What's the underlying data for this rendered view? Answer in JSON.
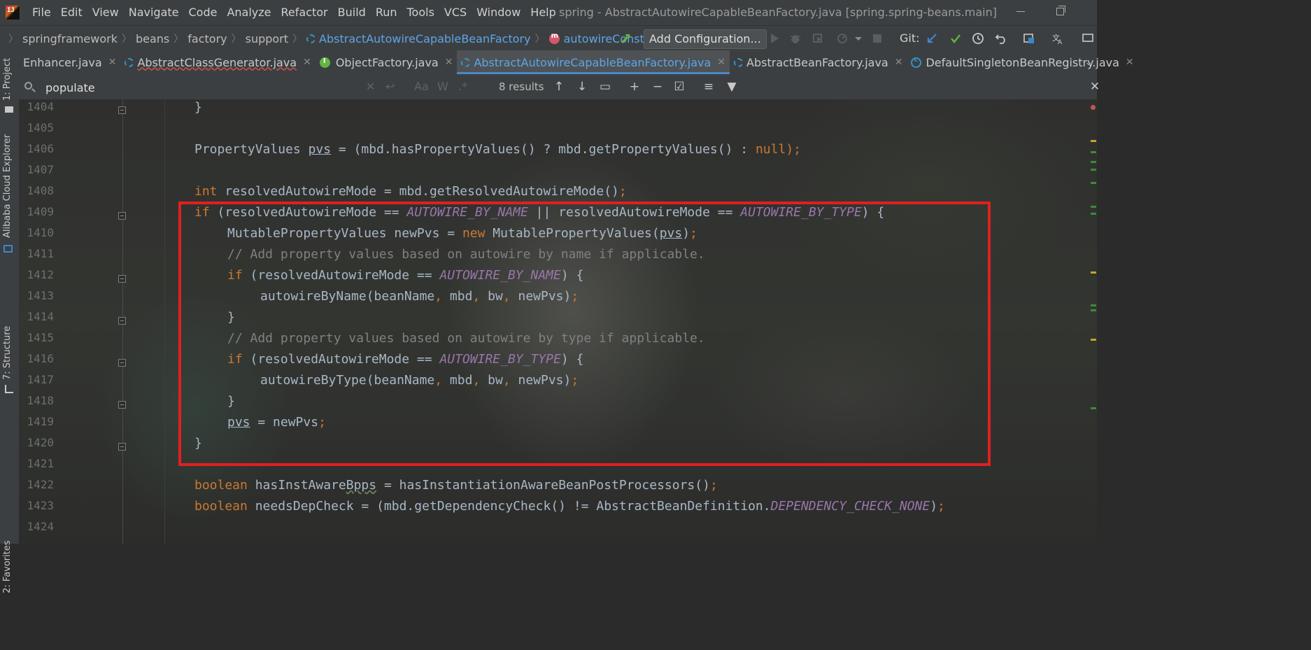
{
  "app": {
    "menu": [
      "File",
      "Edit",
      "View",
      "Navigate",
      "Code",
      "Analyze",
      "Refactor",
      "Build",
      "Run",
      "Tools",
      "VCS",
      "Window",
      "Help"
    ],
    "title": "spring - AbstractAutowireCapableBeanFactory.java [spring.spring-beans.main]"
  },
  "breadcrumb": {
    "items": [
      "springframework",
      "beans",
      "factory",
      "support",
      "AbstractAutowireCapableBeanFactory",
      "autowireConstructor"
    ]
  },
  "toolbar": {
    "add_configuration": "Add Configuration...",
    "git_label": "Git:"
  },
  "left_tools": {
    "project": "1: Project",
    "alibaba": "Alibaba Cloud Explorer",
    "structure": "7: Structure",
    "favorites": "2: Favorites"
  },
  "tabs": [
    {
      "label": "Enhancer.java",
      "icon": "none"
    },
    {
      "label": "AbstractClassGenerator.java",
      "icon": "abstract-class-icon"
    },
    {
      "label": "ObjectFactory.java",
      "icon": "interface-icon"
    },
    {
      "label": "AbstractAutowireCapableBeanFactory.java",
      "icon": "abstract-class-icon",
      "active": true
    },
    {
      "label": "AbstractBeanFactory.java",
      "icon": "abstract-class-icon"
    },
    {
      "label": "DefaultSingletonBeanRegistry.java",
      "icon": "class-icon"
    }
  ],
  "search": {
    "query": "populate",
    "results": "8 results",
    "match_case": "Aa",
    "words": "W",
    "regex": ".*"
  },
  "editor": {
    "line_numbers": [
      "1404",
      "1405",
      "1406",
      "1407",
      "1408",
      "1409",
      "1410",
      "1411",
      "1412",
      "1413",
      "1414",
      "1415",
      "1416",
      "1417",
      "1418",
      "1419",
      "1420",
      "1421",
      "1422",
      "1423",
      "1424"
    ],
    "lines": {
      "l1404": "}",
      "l1406_a": "PropertyValues ",
      "l1406_b": "pvs",
      "l1406_c": " = (mbd.hasPropertyValues() ? mbd.getPropertyValues() : ",
      "l1406_d": "null",
      "l1406_e": ");",
      "l1408_a": "int",
      "l1408_b": " resolvedAutowireMode = mbd.getResolvedAutowireMode()",
      "l1408_c": ";",
      "l1409_a": "if",
      "l1409_b": " (resolvedAutowireMode == ",
      "l1409_c": "AUTOWIRE_BY_NAME",
      "l1409_d": " || resolvedAutowireMode == ",
      "l1409_e": "AUTOWIRE_BY_TYPE",
      "l1409_f": ") {",
      "l1410_a": "MutablePropertyValues newPvs = ",
      "l1410_b": "new",
      "l1410_c": " MutablePropertyValues(",
      "l1410_d": "pvs",
      "l1410_e": ")",
      "l1410_f": ";",
      "l1411": "// Add property values based on autowire by name if applicable.",
      "l1412_a": "if",
      "l1412_b": " (resolvedAutowireMode == ",
      "l1412_c": "AUTOWIRE_BY_NAME",
      "l1412_d": ") {",
      "l1413_a": "autowireByName(beanName",
      "l1413_b": ",",
      "l1413_c": " mbd",
      "l1413_d": ",",
      "l1413_e": " bw",
      "l1413_f": ",",
      "l1413_g": " newPvs)",
      "l1413_h": ";",
      "l1414": "}",
      "l1415": "// Add property values based on autowire by type if applicable.",
      "l1416_a": "if",
      "l1416_b": " (resolvedAutowireMode == ",
      "l1416_c": "AUTOWIRE_BY_TYPE",
      "l1416_d": ") {",
      "l1417_a": "autowireByType(beanName",
      "l1417_b": ",",
      "l1417_c": " mbd",
      "l1417_d": ",",
      "l1417_e": " bw",
      "l1417_f": ",",
      "l1417_g": " newPvs)",
      "l1417_h": ";",
      "l1418": "}",
      "l1419_a": "pvs",
      "l1419_b": " = newPvs",
      "l1419_c": ";",
      "l1420": "}",
      "l1422_a": "boolean",
      "l1422_b": " hasInstAware",
      "l1422_c": "Bpps",
      "l1422_d": " = hasInstantiationAwareBeanPostProcessors()",
      "l1422_e": ";",
      "l1423_a": "boolean",
      "l1423_b": " needsDepCheck = (mbd.getDependencyCheck() != AbstractBeanDefinition.",
      "l1423_c": "DEPENDENCY_CHECK_NONE",
      "l1423_d": ")",
      "l1423_e": ";"
    }
  },
  "colors": {
    "keyword": "#cc7832",
    "constant": "#9876aa",
    "comment": "#808080",
    "text": "#a9b7c6",
    "highlight_box": "#e02020",
    "accent": "#5ea4e8"
  }
}
